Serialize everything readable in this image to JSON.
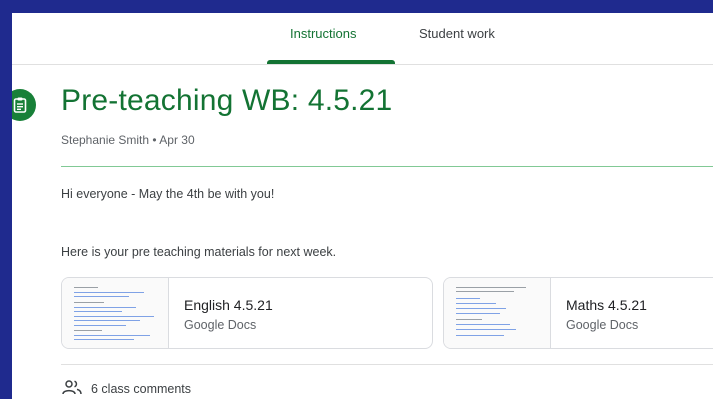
{
  "tabs": [
    {
      "label": "Instructions",
      "active": true
    },
    {
      "label": "Student work",
      "active": false
    }
  ],
  "assignment": {
    "icon": "assignment-icon",
    "title": "Pre-teaching WB: 4.5.21",
    "author": "Stephanie Smith",
    "separator": "•",
    "date": "Apr 30",
    "body_lines": [
      "Hi everyone - May the 4th be with you!",
      "Here is your pre teaching materials for next week."
    ]
  },
  "attachments": [
    {
      "title": "English 4.5.21",
      "type": "Google Docs"
    },
    {
      "title": "Maths 4.5.21",
      "type": "Google Docs"
    }
  ],
  "comments": {
    "icon": "people-icon",
    "label": "6 class comments"
  },
  "colors": {
    "accent_green": "#137333",
    "icon_green": "#188038",
    "frame_blue": "#1f2a8e"
  }
}
